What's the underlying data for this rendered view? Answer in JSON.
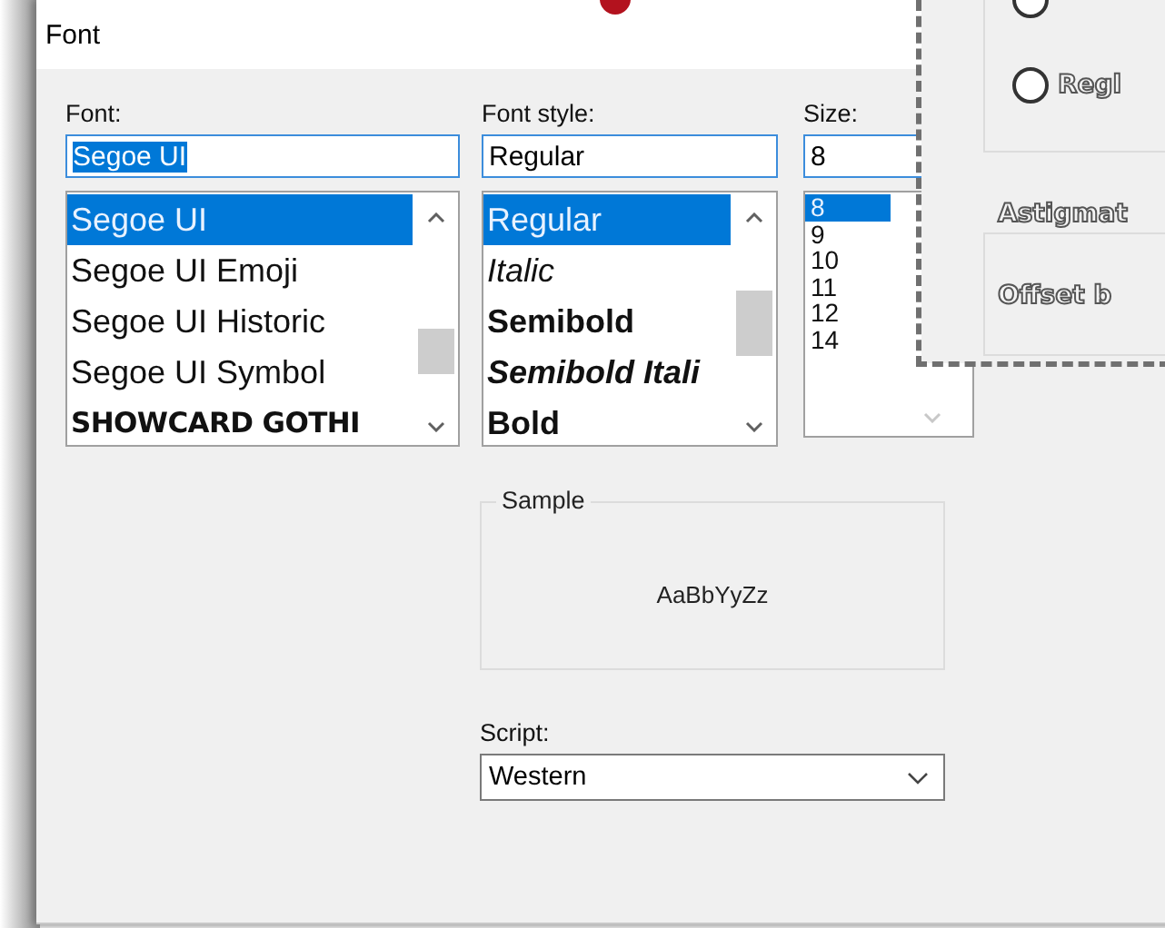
{
  "window": {
    "title": "Font"
  },
  "font": {
    "label": "Font:",
    "value": "Segoe UI",
    "value_selected": true,
    "items": [
      {
        "label": "Segoe UI",
        "selected": true,
        "kind": "regular"
      },
      {
        "label": "Segoe UI Emoji",
        "selected": false,
        "kind": "regular"
      },
      {
        "label": "Segoe UI Historic",
        "selected": false,
        "kind": "regular"
      },
      {
        "label": "Segoe UI Symbol",
        "selected": false,
        "kind": "regular"
      },
      {
        "label": "SHOWCARD GOTHI",
        "selected": false,
        "kind": "display"
      }
    ]
  },
  "font_style": {
    "label": "Font style:",
    "value": "Regular",
    "items": [
      {
        "label": "Regular",
        "selected": true,
        "kind": "regular"
      },
      {
        "label": "Italic",
        "selected": false,
        "kind": "italic"
      },
      {
        "label": "Semibold",
        "selected": false,
        "kind": "bold"
      },
      {
        "label": "Semibold Itali",
        "selected": false,
        "kind": "bold-italic"
      },
      {
        "label": "Bold",
        "selected": false,
        "kind": "bold"
      }
    ]
  },
  "size": {
    "label": "Size:",
    "value": "8",
    "items": [
      {
        "label": "8",
        "selected": true
      },
      {
        "label": "9",
        "selected": false
      },
      {
        "label": "10",
        "selected": false
      },
      {
        "label": "11",
        "selected": false
      },
      {
        "label": "12",
        "selected": false
      },
      {
        "label": "14",
        "selected": false
      }
    ]
  },
  "sample": {
    "label": "Sample",
    "text": "AaBbYyZz"
  },
  "script": {
    "label": "Script:",
    "value": "Western"
  },
  "background_window": {
    "options": [
      {
        "label": "Regl",
        "selected": false
      }
    ],
    "group": {
      "title": "Astigmat",
      "label": "Offset b"
    }
  }
}
